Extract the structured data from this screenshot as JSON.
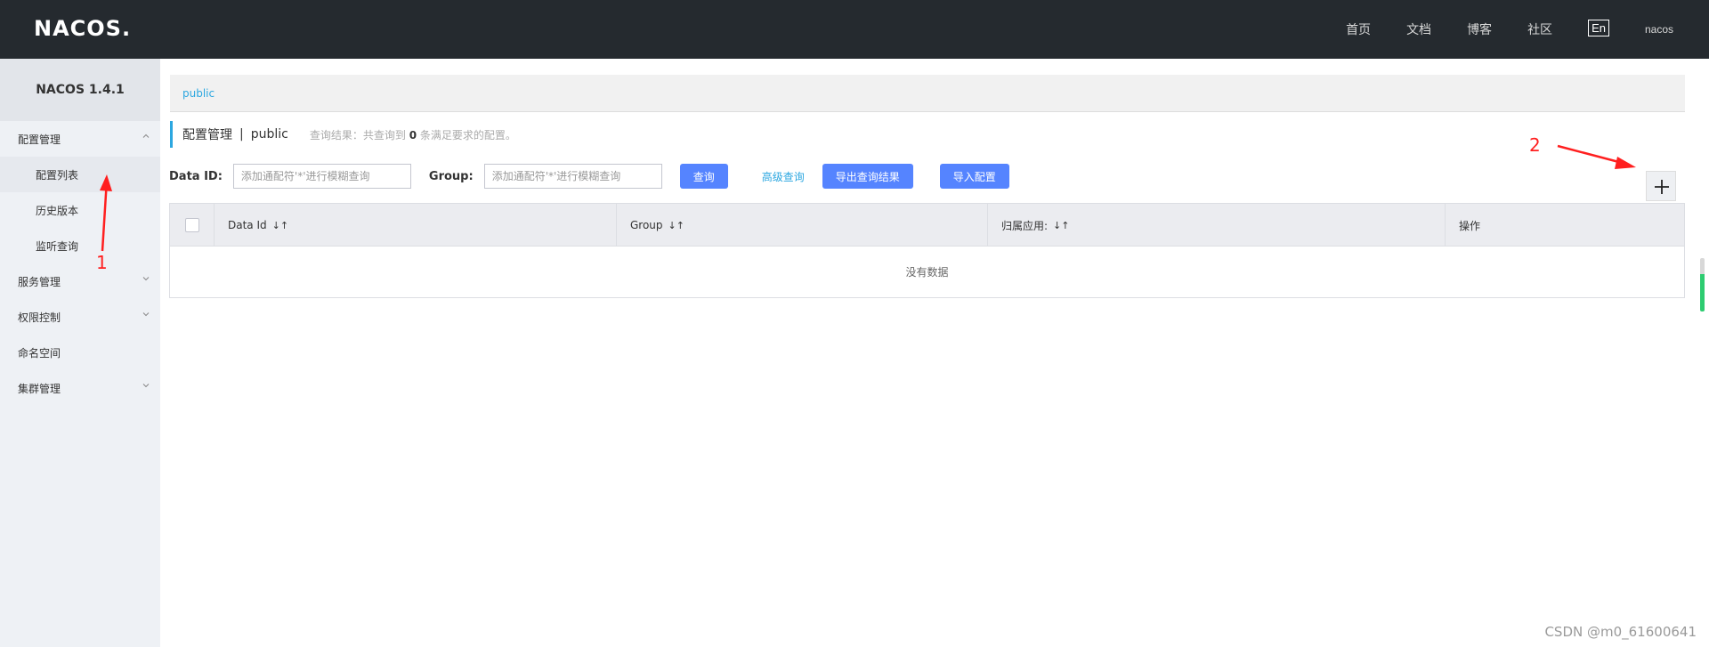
{
  "header": {
    "logo": "NACOS.",
    "nav": [
      "首页",
      "文档",
      "博客",
      "社区"
    ],
    "lang": "En",
    "user": "nacos"
  },
  "sidebar": {
    "title": "NACOS 1.4.1",
    "groups": [
      {
        "label": "配置管理",
        "expanded": true,
        "items": [
          "配置列表",
          "历史版本",
          "监听查询"
        ]
      },
      {
        "label": "服务管理",
        "expanded": false
      },
      {
        "label": "权限控制",
        "expanded": false
      },
      {
        "label": "命名空间"
      },
      {
        "label": "集群管理",
        "expanded": false
      }
    ],
    "active_item": "配置列表"
  },
  "breadcrumb": {
    "namespace": "public"
  },
  "page": {
    "title": "配置管理",
    "separator": "|",
    "namespace": "public",
    "hint_prefix": "查询结果：共查询到",
    "hint_count": "0",
    "hint_suffix": "条满足要求的配置。"
  },
  "filter": {
    "data_id_label": "Data ID:",
    "data_id_placeholder": "添加通配符'*'进行模糊查询",
    "group_label": "Group:",
    "group_placeholder": "添加通配符'*'进行模糊查询",
    "query_button": "查询",
    "advanced_link": "高级查询",
    "export_button": "导出查询结果",
    "import_button": "导入配置"
  },
  "table": {
    "columns": [
      "Data Id",
      "Group",
      "归属应用:",
      "操作"
    ],
    "sort_glyph": "↓↑",
    "empty_text": "没有数据"
  },
  "annotations": {
    "one": "1",
    "two": "2"
  },
  "watermark": "CSDN @m0_61600641",
  "colors": {
    "header_bg": "#252a2f",
    "primary": "#5584ff",
    "accent": "#2ca7e0",
    "annotation": "#ff1f1f"
  },
  "icons": {
    "add": "plus-icon"
  }
}
